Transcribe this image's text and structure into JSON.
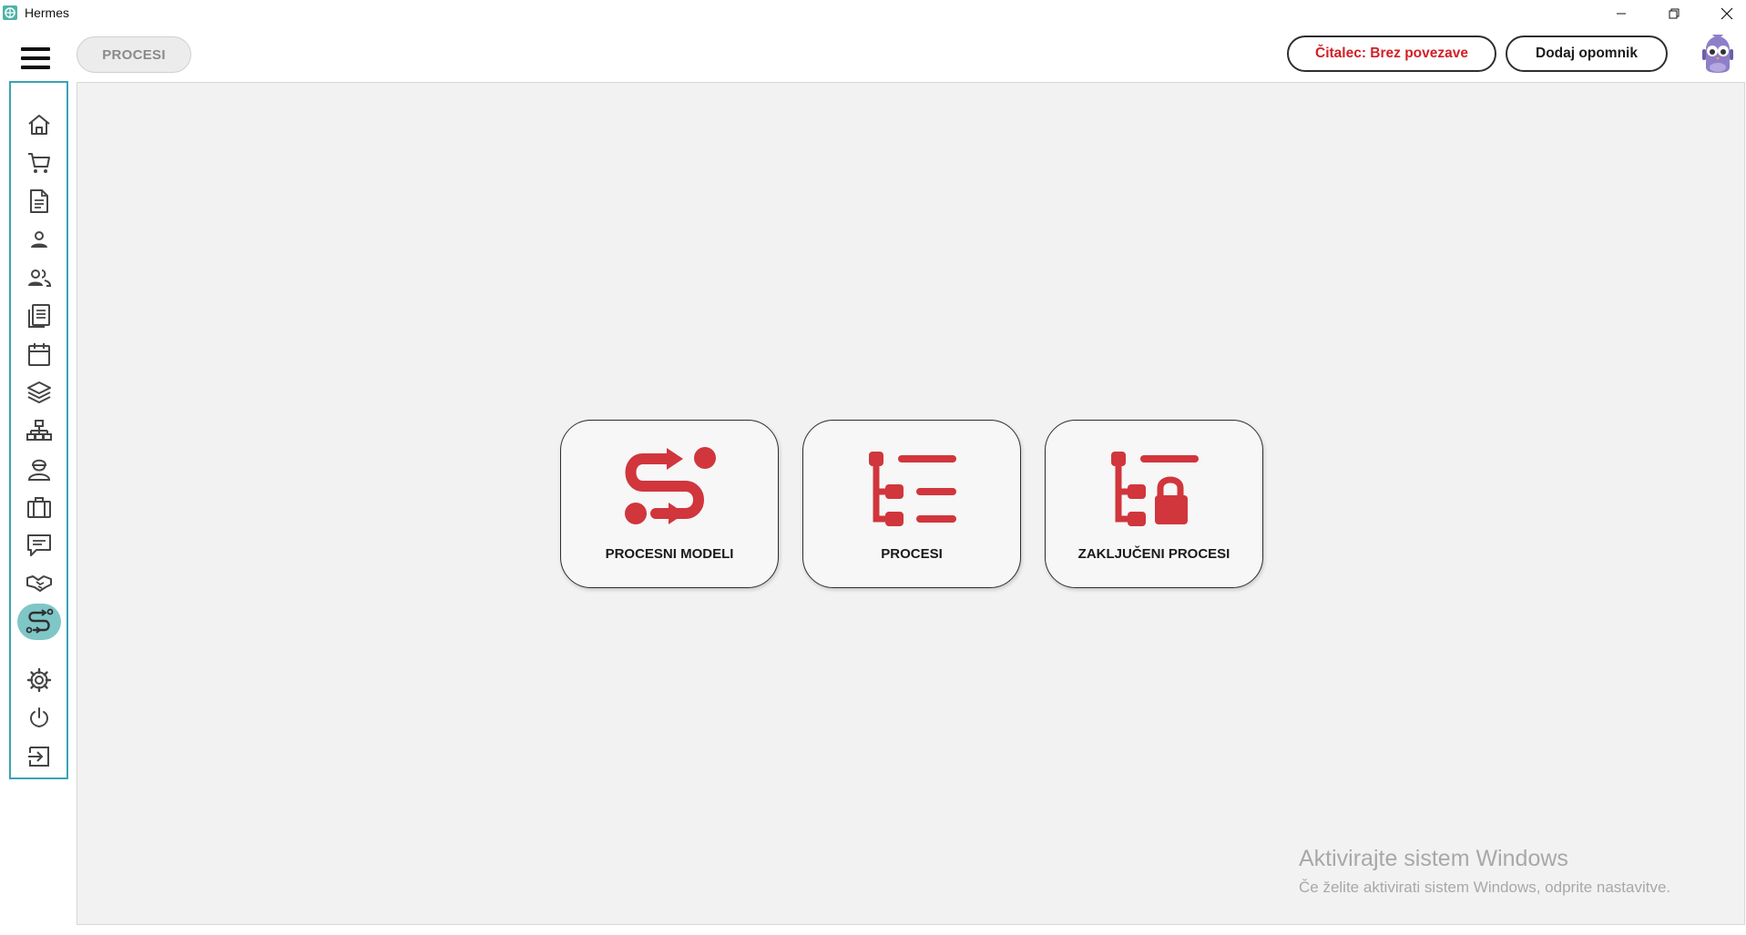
{
  "window": {
    "title": "Hermes",
    "controls": [
      "minimize",
      "restore",
      "close"
    ]
  },
  "header": {
    "breadcrumb": "PROCESI",
    "reader_status": "Čitalec: Brez povezave",
    "add_reminder": "Dodaj opomnik"
  },
  "sidebar": {
    "items": [
      {
        "icon": "home-icon"
      },
      {
        "icon": "cart-icon"
      },
      {
        "icon": "document-icon"
      },
      {
        "icon": "person-icon"
      },
      {
        "icon": "people-icon"
      },
      {
        "icon": "news-icon"
      },
      {
        "icon": "calendar-icon"
      },
      {
        "icon": "layers-icon"
      },
      {
        "icon": "hierarchy-icon"
      },
      {
        "icon": "worker-icon"
      },
      {
        "icon": "briefcase-icon"
      },
      {
        "icon": "message-icon"
      },
      {
        "icon": "handshake-icon"
      },
      {
        "icon": "process-icon",
        "active": true
      },
      {
        "icon": "gear-icon"
      },
      {
        "icon": "power-icon"
      },
      {
        "icon": "logout-icon"
      }
    ]
  },
  "main": {
    "cards": [
      {
        "label": "PROCESNI MODELI",
        "icon": "process-model-icon"
      },
      {
        "label": "PROCESI",
        "icon": "process-list-icon"
      },
      {
        "label": "ZAKLJUČENI PROCESI",
        "icon": "closed-process-icon"
      }
    ]
  },
  "watermark": {
    "title": "Aktivirajte sistem Windows",
    "subtitle": "Če želite aktivirati sistem Windows, odprite nastavitve."
  },
  "colors": {
    "accent": "#3aa3b6",
    "active_bg": "#7fc6c7",
    "icon_red": "#d0363c",
    "status_red": "#d21f26",
    "panel_bg": "#f2f2f2"
  }
}
